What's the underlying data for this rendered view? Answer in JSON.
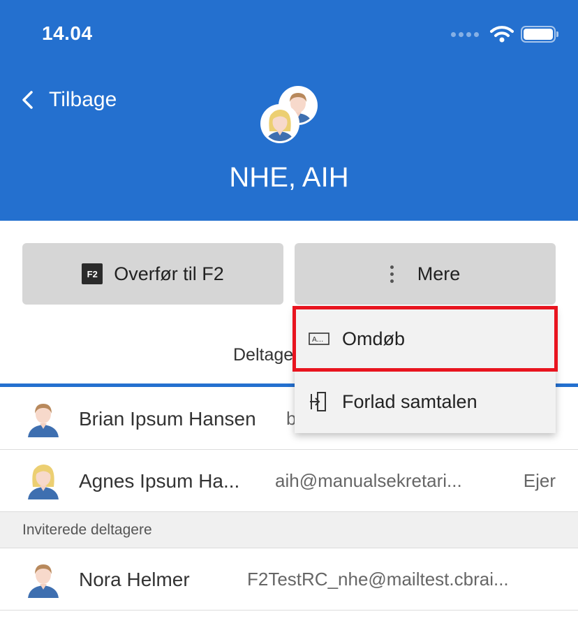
{
  "status_bar": {
    "time": "14.04"
  },
  "header": {
    "back_label": "Tilbage",
    "title": "NHE, AIH",
    "accent_color": "#2470cf"
  },
  "actions": {
    "transfer_icon_text": "F2",
    "transfer_label": "Overfør til F2",
    "more_label": "Mere"
  },
  "tabs": {
    "participants_label": "Deltage"
  },
  "participants": [
    {
      "name": "Brian Ipsum Hansen",
      "email": "b",
      "role": "",
      "avatar": "male-avatar-icon"
    },
    {
      "name": "Agnes Ipsum Ha...",
      "email": "aih@manualsekretari...",
      "role": "Ejer",
      "avatar": "female-avatar-icon"
    }
  ],
  "invited": {
    "heading": "Inviterede deltagere",
    "items": [
      {
        "name": "Nora Helmer",
        "email": "F2TestRC_nhe@mailtest.cbrai...",
        "avatar": "male-avatar-icon"
      }
    ]
  },
  "menu": {
    "items": [
      {
        "label": "Omdøb",
        "icon": "rename-icon",
        "highlighted": true
      },
      {
        "label": "Forlad samtalen",
        "icon": "leave-icon",
        "highlighted": false
      }
    ],
    "highlight_color": "#e8141f"
  }
}
